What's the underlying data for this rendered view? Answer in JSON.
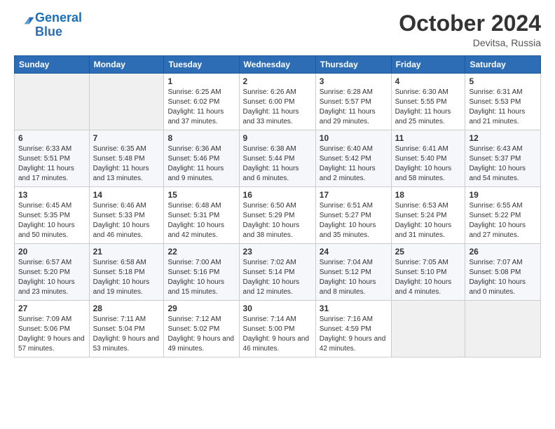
{
  "header": {
    "logo_line1": "General",
    "logo_line2": "Blue",
    "month": "October 2024",
    "location": "Devitsa, Russia"
  },
  "weekdays": [
    "Sunday",
    "Monday",
    "Tuesday",
    "Wednesday",
    "Thursday",
    "Friday",
    "Saturday"
  ],
  "weeks": [
    [
      {
        "day": "",
        "sunrise": "",
        "sunset": "",
        "daylight": ""
      },
      {
        "day": "",
        "sunrise": "",
        "sunset": "",
        "daylight": ""
      },
      {
        "day": "1",
        "sunrise": "Sunrise: 6:25 AM",
        "sunset": "Sunset: 6:02 PM",
        "daylight": "Daylight: 11 hours and 37 minutes."
      },
      {
        "day": "2",
        "sunrise": "Sunrise: 6:26 AM",
        "sunset": "Sunset: 6:00 PM",
        "daylight": "Daylight: 11 hours and 33 minutes."
      },
      {
        "day": "3",
        "sunrise": "Sunrise: 6:28 AM",
        "sunset": "Sunset: 5:57 PM",
        "daylight": "Daylight: 11 hours and 29 minutes."
      },
      {
        "day": "4",
        "sunrise": "Sunrise: 6:30 AM",
        "sunset": "Sunset: 5:55 PM",
        "daylight": "Daylight: 11 hours and 25 minutes."
      },
      {
        "day": "5",
        "sunrise": "Sunrise: 6:31 AM",
        "sunset": "Sunset: 5:53 PM",
        "daylight": "Daylight: 11 hours and 21 minutes."
      }
    ],
    [
      {
        "day": "6",
        "sunrise": "Sunrise: 6:33 AM",
        "sunset": "Sunset: 5:51 PM",
        "daylight": "Daylight: 11 hours and 17 minutes."
      },
      {
        "day": "7",
        "sunrise": "Sunrise: 6:35 AM",
        "sunset": "Sunset: 5:48 PM",
        "daylight": "Daylight: 11 hours and 13 minutes."
      },
      {
        "day": "8",
        "sunrise": "Sunrise: 6:36 AM",
        "sunset": "Sunset: 5:46 PM",
        "daylight": "Daylight: 11 hours and 9 minutes."
      },
      {
        "day": "9",
        "sunrise": "Sunrise: 6:38 AM",
        "sunset": "Sunset: 5:44 PM",
        "daylight": "Daylight: 11 hours and 6 minutes."
      },
      {
        "day": "10",
        "sunrise": "Sunrise: 6:40 AM",
        "sunset": "Sunset: 5:42 PM",
        "daylight": "Daylight: 11 hours and 2 minutes."
      },
      {
        "day": "11",
        "sunrise": "Sunrise: 6:41 AM",
        "sunset": "Sunset: 5:40 PM",
        "daylight": "Daylight: 10 hours and 58 minutes."
      },
      {
        "day": "12",
        "sunrise": "Sunrise: 6:43 AM",
        "sunset": "Sunset: 5:37 PM",
        "daylight": "Daylight: 10 hours and 54 minutes."
      }
    ],
    [
      {
        "day": "13",
        "sunrise": "Sunrise: 6:45 AM",
        "sunset": "Sunset: 5:35 PM",
        "daylight": "Daylight: 10 hours and 50 minutes."
      },
      {
        "day": "14",
        "sunrise": "Sunrise: 6:46 AM",
        "sunset": "Sunset: 5:33 PM",
        "daylight": "Daylight: 10 hours and 46 minutes."
      },
      {
        "day": "15",
        "sunrise": "Sunrise: 6:48 AM",
        "sunset": "Sunset: 5:31 PM",
        "daylight": "Daylight: 10 hours and 42 minutes."
      },
      {
        "day": "16",
        "sunrise": "Sunrise: 6:50 AM",
        "sunset": "Sunset: 5:29 PM",
        "daylight": "Daylight: 10 hours and 38 minutes."
      },
      {
        "day": "17",
        "sunrise": "Sunrise: 6:51 AM",
        "sunset": "Sunset: 5:27 PM",
        "daylight": "Daylight: 10 hours and 35 minutes."
      },
      {
        "day": "18",
        "sunrise": "Sunrise: 6:53 AM",
        "sunset": "Sunset: 5:24 PM",
        "daylight": "Daylight: 10 hours and 31 minutes."
      },
      {
        "day": "19",
        "sunrise": "Sunrise: 6:55 AM",
        "sunset": "Sunset: 5:22 PM",
        "daylight": "Daylight: 10 hours and 27 minutes."
      }
    ],
    [
      {
        "day": "20",
        "sunrise": "Sunrise: 6:57 AM",
        "sunset": "Sunset: 5:20 PM",
        "daylight": "Daylight: 10 hours and 23 minutes."
      },
      {
        "day": "21",
        "sunrise": "Sunrise: 6:58 AM",
        "sunset": "Sunset: 5:18 PM",
        "daylight": "Daylight: 10 hours and 19 minutes."
      },
      {
        "day": "22",
        "sunrise": "Sunrise: 7:00 AM",
        "sunset": "Sunset: 5:16 PM",
        "daylight": "Daylight: 10 hours and 15 minutes."
      },
      {
        "day": "23",
        "sunrise": "Sunrise: 7:02 AM",
        "sunset": "Sunset: 5:14 PM",
        "daylight": "Daylight: 10 hours and 12 minutes."
      },
      {
        "day": "24",
        "sunrise": "Sunrise: 7:04 AM",
        "sunset": "Sunset: 5:12 PM",
        "daylight": "Daylight: 10 hours and 8 minutes."
      },
      {
        "day": "25",
        "sunrise": "Sunrise: 7:05 AM",
        "sunset": "Sunset: 5:10 PM",
        "daylight": "Daylight: 10 hours and 4 minutes."
      },
      {
        "day": "26",
        "sunrise": "Sunrise: 7:07 AM",
        "sunset": "Sunset: 5:08 PM",
        "daylight": "Daylight: 10 hours and 0 minutes."
      }
    ],
    [
      {
        "day": "27",
        "sunrise": "Sunrise: 7:09 AM",
        "sunset": "Sunset: 5:06 PM",
        "daylight": "Daylight: 9 hours and 57 minutes."
      },
      {
        "day": "28",
        "sunrise": "Sunrise: 7:11 AM",
        "sunset": "Sunset: 5:04 PM",
        "daylight": "Daylight: 9 hours and 53 minutes."
      },
      {
        "day": "29",
        "sunrise": "Sunrise: 7:12 AM",
        "sunset": "Sunset: 5:02 PM",
        "daylight": "Daylight: 9 hours and 49 minutes."
      },
      {
        "day": "30",
        "sunrise": "Sunrise: 7:14 AM",
        "sunset": "Sunset: 5:00 PM",
        "daylight": "Daylight: 9 hours and 46 minutes."
      },
      {
        "day": "31",
        "sunrise": "Sunrise: 7:16 AM",
        "sunset": "Sunset: 4:59 PM",
        "daylight": "Daylight: 9 hours and 42 minutes."
      },
      {
        "day": "",
        "sunrise": "",
        "sunset": "",
        "daylight": ""
      },
      {
        "day": "",
        "sunrise": "",
        "sunset": "",
        "daylight": ""
      }
    ]
  ]
}
